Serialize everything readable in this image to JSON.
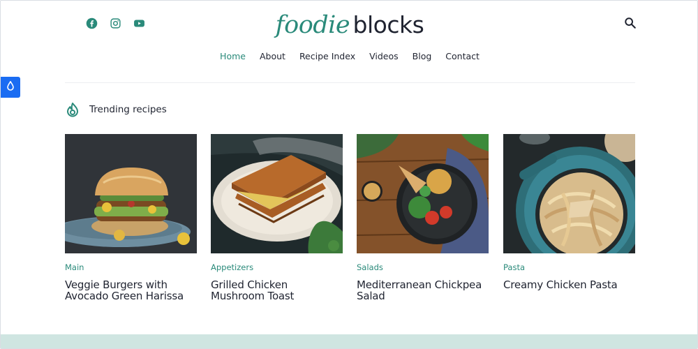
{
  "site": {
    "logo_part1": "foodie",
    "logo_part2": "blocks"
  },
  "social": [
    "facebook-icon",
    "instagram-icon",
    "youtube-icon"
  ],
  "nav": {
    "items": [
      {
        "label": "Home",
        "active": true
      },
      {
        "label": "About",
        "active": false
      },
      {
        "label": "Recipe Index",
        "active": false
      },
      {
        "label": "Videos",
        "active": false
      },
      {
        "label": "Blog",
        "active": false
      },
      {
        "label": "Contact",
        "active": false
      }
    ]
  },
  "trending": {
    "title": "Trending recipes",
    "icon": "flame-icon",
    "cards": [
      {
        "category": "Main",
        "title": "Veggie Burgers with Avocado Green Harissa"
      },
      {
        "category": "Appetizers",
        "title": "Grilled Chicken Mushroom Toast"
      },
      {
        "category": "Salads",
        "title": "Mediterranean Chickpea Salad"
      },
      {
        "category": "Pasta",
        "title": "Creamy Chicken Pasta"
      }
    ]
  },
  "colors": {
    "accent": "#2a8a7a",
    "text": "#1f2330",
    "side_button": "#1a6cf2",
    "footer_band": "#cfe5e1"
  }
}
